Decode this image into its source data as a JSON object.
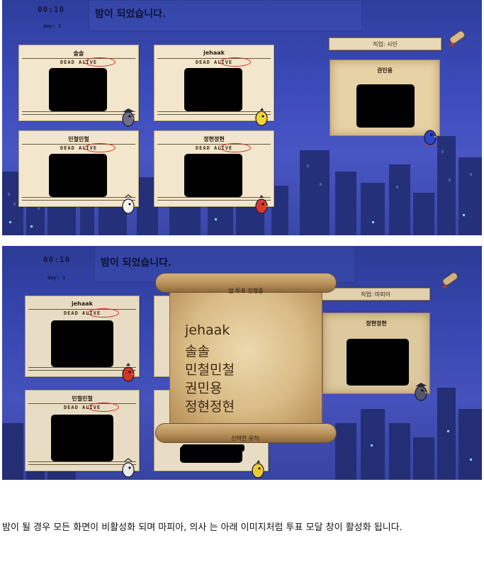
{
  "colors": {
    "sky": "#3a4ab8",
    "card": "#f2e6cc",
    "alive_ring": "#d8272a",
    "parchment": "#e7d2a6"
  },
  "screen1": {
    "clock": "00:10",
    "day": "day: 1",
    "message": "밤이 되었습니다.",
    "players": [
      {
        "name": "솔솔",
        "tag": "DEAD ALIVE",
        "bird_color": "#6e6e88",
        "bird_icon": "crow-icon"
      },
      {
        "name": "jehaak",
        "tag": "DEAD ALIVE",
        "bird_color": "#f4d437",
        "bird_icon": "bird-icon"
      },
      {
        "name": "민철민철",
        "tag": "DEAD ALIVE",
        "bird_color": "#f3f3f3",
        "bird_icon": "bird-icon"
      },
      {
        "name": "정현정현",
        "tag": "DEAD ALIVE",
        "bird_color": "#d93a2c",
        "bird_icon": "bird-icon"
      }
    ],
    "job_label": "직업: 시민",
    "role_name": "권민용",
    "role_bird_color": "#2c46c8"
  },
  "screen2": {
    "clock": "00:10",
    "day": "day: 1",
    "message": "밤이 되었습니다.",
    "players": [
      {
        "name": "jehaak",
        "tag": "DEAD ALIVE",
        "bird_color": "#d93a2c"
      },
      {
        "name": "민철민철",
        "tag": "DEAD ALIVE",
        "bird_color": "#f3f3f3"
      }
    ],
    "job_label": "직업: 마피아",
    "role_name": "정현정현",
    "role_bird_color": "#5a5a72",
    "bottom_bird_color": "#f4d437",
    "modal": {
      "title": "밤 투표 진행중",
      "options": [
        "jehaak",
        "솔솔",
        "민철민철",
        "권민용",
        "정현정현"
      ],
      "selected_label": "선택한 유저:"
    }
  },
  "caption": "밤이 될 경우 모든 화면이 비활성화 되며 마피아, 의사 는 아래 이미지처럼 투표 모달 창이 활성화 됩니다."
}
